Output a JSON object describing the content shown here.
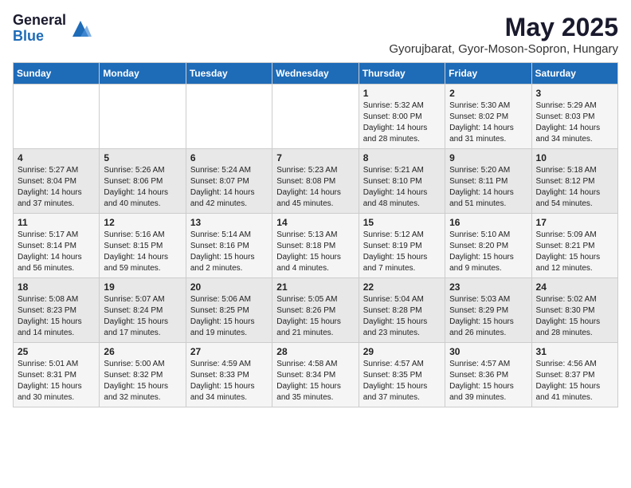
{
  "logo": {
    "general": "General",
    "blue": "Blue"
  },
  "header": {
    "month": "May 2025",
    "location": "Gyorujbarat, Gyor-Moson-Sopron, Hungary"
  },
  "weekdays": [
    "Sunday",
    "Monday",
    "Tuesday",
    "Wednesday",
    "Thursday",
    "Friday",
    "Saturday"
  ],
  "weeks": [
    [
      {
        "day": "",
        "info": ""
      },
      {
        "day": "",
        "info": ""
      },
      {
        "day": "",
        "info": ""
      },
      {
        "day": "",
        "info": ""
      },
      {
        "day": "1",
        "info": "Sunrise: 5:32 AM\nSunset: 8:00 PM\nDaylight: 14 hours\nand 28 minutes."
      },
      {
        "day": "2",
        "info": "Sunrise: 5:30 AM\nSunset: 8:02 PM\nDaylight: 14 hours\nand 31 minutes."
      },
      {
        "day": "3",
        "info": "Sunrise: 5:29 AM\nSunset: 8:03 PM\nDaylight: 14 hours\nand 34 minutes."
      }
    ],
    [
      {
        "day": "4",
        "info": "Sunrise: 5:27 AM\nSunset: 8:04 PM\nDaylight: 14 hours\nand 37 minutes."
      },
      {
        "day": "5",
        "info": "Sunrise: 5:26 AM\nSunset: 8:06 PM\nDaylight: 14 hours\nand 40 minutes."
      },
      {
        "day": "6",
        "info": "Sunrise: 5:24 AM\nSunset: 8:07 PM\nDaylight: 14 hours\nand 42 minutes."
      },
      {
        "day": "7",
        "info": "Sunrise: 5:23 AM\nSunset: 8:08 PM\nDaylight: 14 hours\nand 45 minutes."
      },
      {
        "day": "8",
        "info": "Sunrise: 5:21 AM\nSunset: 8:10 PM\nDaylight: 14 hours\nand 48 minutes."
      },
      {
        "day": "9",
        "info": "Sunrise: 5:20 AM\nSunset: 8:11 PM\nDaylight: 14 hours\nand 51 minutes."
      },
      {
        "day": "10",
        "info": "Sunrise: 5:18 AM\nSunset: 8:12 PM\nDaylight: 14 hours\nand 54 minutes."
      }
    ],
    [
      {
        "day": "11",
        "info": "Sunrise: 5:17 AM\nSunset: 8:14 PM\nDaylight: 14 hours\nand 56 minutes."
      },
      {
        "day": "12",
        "info": "Sunrise: 5:16 AM\nSunset: 8:15 PM\nDaylight: 14 hours\nand 59 minutes."
      },
      {
        "day": "13",
        "info": "Sunrise: 5:14 AM\nSunset: 8:16 PM\nDaylight: 15 hours\nand 2 minutes."
      },
      {
        "day": "14",
        "info": "Sunrise: 5:13 AM\nSunset: 8:18 PM\nDaylight: 15 hours\nand 4 minutes."
      },
      {
        "day": "15",
        "info": "Sunrise: 5:12 AM\nSunset: 8:19 PM\nDaylight: 15 hours\nand 7 minutes."
      },
      {
        "day": "16",
        "info": "Sunrise: 5:10 AM\nSunset: 8:20 PM\nDaylight: 15 hours\nand 9 minutes."
      },
      {
        "day": "17",
        "info": "Sunrise: 5:09 AM\nSunset: 8:21 PM\nDaylight: 15 hours\nand 12 minutes."
      }
    ],
    [
      {
        "day": "18",
        "info": "Sunrise: 5:08 AM\nSunset: 8:23 PM\nDaylight: 15 hours\nand 14 minutes."
      },
      {
        "day": "19",
        "info": "Sunrise: 5:07 AM\nSunset: 8:24 PM\nDaylight: 15 hours\nand 17 minutes."
      },
      {
        "day": "20",
        "info": "Sunrise: 5:06 AM\nSunset: 8:25 PM\nDaylight: 15 hours\nand 19 minutes."
      },
      {
        "day": "21",
        "info": "Sunrise: 5:05 AM\nSunset: 8:26 PM\nDaylight: 15 hours\nand 21 minutes."
      },
      {
        "day": "22",
        "info": "Sunrise: 5:04 AM\nSunset: 8:28 PM\nDaylight: 15 hours\nand 23 minutes."
      },
      {
        "day": "23",
        "info": "Sunrise: 5:03 AM\nSunset: 8:29 PM\nDaylight: 15 hours\nand 26 minutes."
      },
      {
        "day": "24",
        "info": "Sunrise: 5:02 AM\nSunset: 8:30 PM\nDaylight: 15 hours\nand 28 minutes."
      }
    ],
    [
      {
        "day": "25",
        "info": "Sunrise: 5:01 AM\nSunset: 8:31 PM\nDaylight: 15 hours\nand 30 minutes."
      },
      {
        "day": "26",
        "info": "Sunrise: 5:00 AM\nSunset: 8:32 PM\nDaylight: 15 hours\nand 32 minutes."
      },
      {
        "day": "27",
        "info": "Sunrise: 4:59 AM\nSunset: 8:33 PM\nDaylight: 15 hours\nand 34 minutes."
      },
      {
        "day": "28",
        "info": "Sunrise: 4:58 AM\nSunset: 8:34 PM\nDaylight: 15 hours\nand 35 minutes."
      },
      {
        "day": "29",
        "info": "Sunrise: 4:57 AM\nSunset: 8:35 PM\nDaylight: 15 hours\nand 37 minutes."
      },
      {
        "day": "30",
        "info": "Sunrise: 4:57 AM\nSunset: 8:36 PM\nDaylight: 15 hours\nand 39 minutes."
      },
      {
        "day": "31",
        "info": "Sunrise: 4:56 AM\nSunset: 8:37 PM\nDaylight: 15 hours\nand 41 minutes."
      }
    ]
  ]
}
